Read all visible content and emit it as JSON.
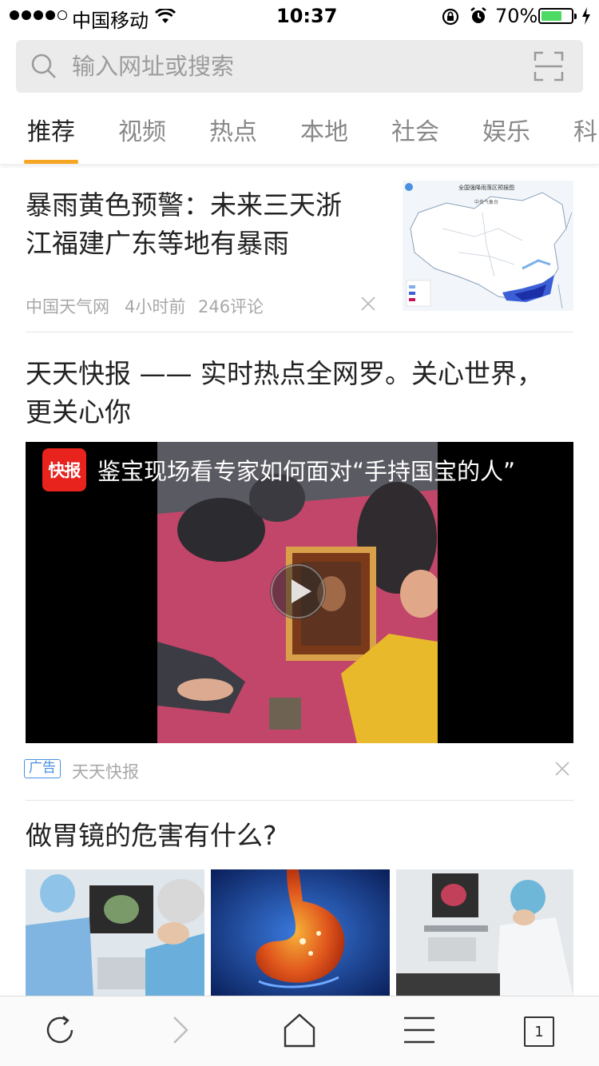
{
  "status_bar": {
    "carrier": "中国移动",
    "time": "10:37",
    "battery_percent": "70%",
    "battery_level": 0.7,
    "signal_bars_filled": 4,
    "signal_bars_total": 5
  },
  "search": {
    "placeholder": "输入网址或搜索"
  },
  "tabs": [
    {
      "label": "推荐",
      "active": true
    },
    {
      "label": "视频",
      "active": false
    },
    {
      "label": "热点",
      "active": false
    },
    {
      "label": "本地",
      "active": false
    },
    {
      "label": "社会",
      "active": false
    },
    {
      "label": "娱乐",
      "active": false
    },
    {
      "label": "科",
      "active": false
    }
  ],
  "feed": {
    "article1": {
      "title_line1": "暴雨黄色预警：未来三天浙",
      "title_line2": "江福建广东等地有暴雨",
      "source": "中国天气网",
      "time": "4小时前",
      "comments": "246评论",
      "thumb_title": "全国强降雨落区预报图",
      "thumb_subtitle": "中央气象台"
    },
    "article2": {
      "title_line1": "天天快报 —— 实时热点全网罗。关心世界，",
      "title_line2": "更关心你",
      "video_title": "鉴宝现场看专家如何面对“手持国宝的人”",
      "logo_text": "快报",
      "ad_label": "广告",
      "source": "天天快报"
    },
    "article3": {
      "title": "做胃镜的危害有什么?"
    }
  },
  "toolbar": {
    "tab_count": "1"
  },
  "colors": {
    "accent": "#f5a623",
    "ad_blue": "#4a90e2",
    "battery_green": "#4cd964",
    "logo_red": "#e8231e"
  }
}
